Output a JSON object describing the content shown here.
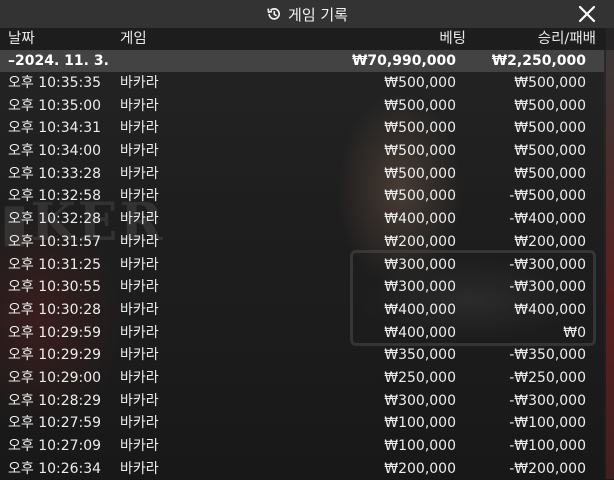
{
  "window": {
    "title": "게임 기록"
  },
  "icons": {
    "history": "history-icon",
    "close": "close-icon"
  },
  "header": {
    "date": "날짜",
    "game": "게임",
    "bet": "베팅",
    "result": "승리/패배"
  },
  "summary": {
    "date": "–2024. 11. 3.",
    "bet": "₩70,990,000",
    "result": "₩2,250,000"
  },
  "rows": [
    {
      "time": "오후 10:35:35",
      "game": "바카라",
      "bet": "₩500,000",
      "result": "₩500,000"
    },
    {
      "time": "오후 10:35:00",
      "game": "바카라",
      "bet": "₩500,000",
      "result": "₩500,000"
    },
    {
      "time": "오후 10:34:31",
      "game": "바카라",
      "bet": "₩500,000",
      "result": "₩500,000"
    },
    {
      "time": "오후 10:34:00",
      "game": "바카라",
      "bet": "₩500,000",
      "result": "₩500,000"
    },
    {
      "time": "오후 10:33:28",
      "game": "바카라",
      "bet": "₩500,000",
      "result": "₩500,000"
    },
    {
      "time": "오후 10:32:58",
      "game": "바카라",
      "bet": "₩500,000",
      "result": "-₩500,000"
    },
    {
      "time": "오후 10:32:28",
      "game": "바카라",
      "bet": "₩400,000",
      "result": "-₩400,000"
    },
    {
      "time": "오후 10:31:57",
      "game": "바카라",
      "bet": "₩200,000",
      "result": "₩200,000"
    },
    {
      "time": "오후 10:31:25",
      "game": "바카라",
      "bet": "₩300,000",
      "result": "-₩300,000"
    },
    {
      "time": "오후 10:30:55",
      "game": "바카라",
      "bet": "₩300,000",
      "result": "-₩300,000"
    },
    {
      "time": "오후 10:30:28",
      "game": "바카라",
      "bet": "₩400,000",
      "result": "₩400,000"
    },
    {
      "time": "오후 10:29:59",
      "game": "바카라",
      "bet": "₩400,000",
      "result": "₩0"
    },
    {
      "time": "오후 10:29:29",
      "game": "바카라",
      "bet": "₩350,000",
      "result": "-₩350,000"
    },
    {
      "time": "오후 10:29:00",
      "game": "바카라",
      "bet": "₩250,000",
      "result": "-₩250,000"
    },
    {
      "time": "오후 10:28:29",
      "game": "바카라",
      "bet": "₩300,000",
      "result": "-₩300,000"
    },
    {
      "time": "오후 10:27:59",
      "game": "바카라",
      "bet": "₩100,000",
      "result": "-₩100,000"
    },
    {
      "time": "오후 10:27:09",
      "game": "바카라",
      "bet": "₩100,000",
      "result": "-₩100,000"
    },
    {
      "time": "오후 10:26:34",
      "game": "바카라",
      "bet": "₩200,000",
      "result": "-₩200,000"
    }
  ],
  "colors": {
    "titlebar": "#333333",
    "summary_row": "#5a5a5a",
    "text": "#ececec"
  }
}
